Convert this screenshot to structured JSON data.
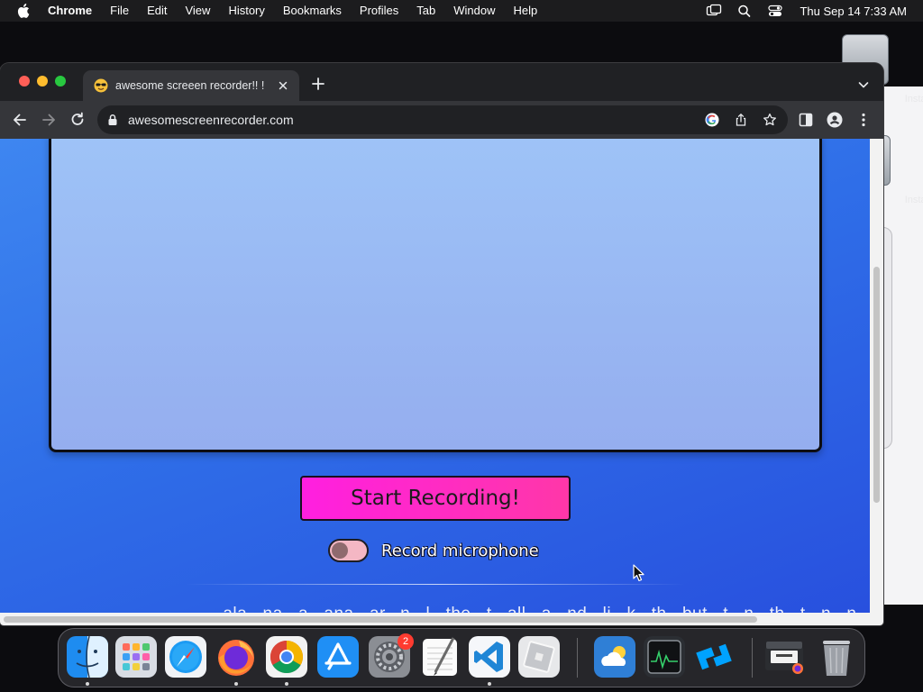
{
  "menubar": {
    "app_name": "Chrome",
    "items": [
      "File",
      "Edit",
      "View",
      "History",
      "Bookmarks",
      "Profiles",
      "Tab",
      "Window",
      "Help"
    ],
    "clock": "Thu Sep 14  7:33 AM"
  },
  "desktop": {
    "labels": [
      "Instal",
      "Instal"
    ]
  },
  "browser": {
    "tab": {
      "title": "awesome screeen recorder!! !"
    },
    "address": {
      "url": "awesomescreenrecorder.com"
    }
  },
  "page": {
    "start_button": "Start Recording!",
    "mic_toggle": {
      "label": "Record microphone",
      "enabled": false
    },
    "cut_text": "...ala...na...a...ana...ar...n...l...the...t...all...a...nd...li...k...th...but...t...n...th...t...n...n...ll...t...a...t"
  },
  "dock": {
    "apps": [
      "Finder",
      "Launchpad",
      "Safari",
      "Firefox",
      "Google Chrome",
      "App Store",
      "System Settings",
      "TextEdit",
      "Visual Studio Code",
      "Roblox",
      "Weather",
      "Activity Monitor",
      "Roblox Studio",
      "Downloads",
      "Trash"
    ],
    "settings_badge": "2"
  },
  "colors": {
    "page_gradient_start": "#3e86f0",
    "page_gradient_end": "#2850de",
    "start_button": "#ff1fe0",
    "toggle_track": "#f4b7c4"
  },
  "icons": [
    "apple-icon",
    "screen-mirror-icon",
    "search-icon",
    "control-center-icon",
    "favicon-icon",
    "close-icon",
    "plus-icon",
    "chevron-down-icon",
    "back-icon",
    "forward-icon",
    "reload-icon",
    "lock-icon",
    "google-icon",
    "share-icon",
    "star-icon",
    "side-panel-icon",
    "profile-icon",
    "more-icon"
  ]
}
